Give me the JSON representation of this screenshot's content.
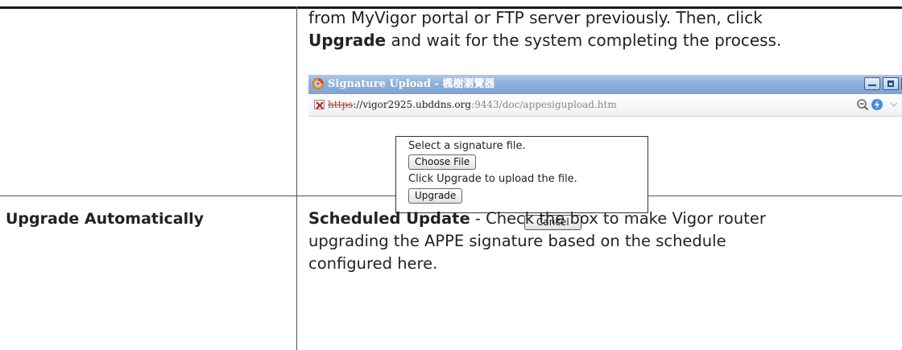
{
  "instructions": {
    "line1": "from MyVigor portal or FTP server previously. Then, click",
    "line2_bold": "Upgrade",
    "line2_rest": " and wait for the system completing the process."
  },
  "browser": {
    "title": "Signature Upload - 楓樹瀏覽器",
    "url_scheme": "https",
    "url_host": "://vigor2925.ubddns.org",
    "url_port_path": ":9443/doc/appesigupload.htm"
  },
  "upload_dialog": {
    "select_text": "Select a signature file.",
    "choose_file_label": "Choose File",
    "hint_text": "Click Upgrade to upload the file.",
    "upgrade_label": "Upgrade",
    "cancel_label": "Cancel"
  },
  "row2": {
    "label": "Upgrade Automatically",
    "desc_bold": "Scheduled Update",
    "desc_line1_rest": " - Check the box to make Vigor router",
    "desc_line2": "upgrading the APPE signature based on the schedule",
    "desc_line3": "configured here."
  }
}
